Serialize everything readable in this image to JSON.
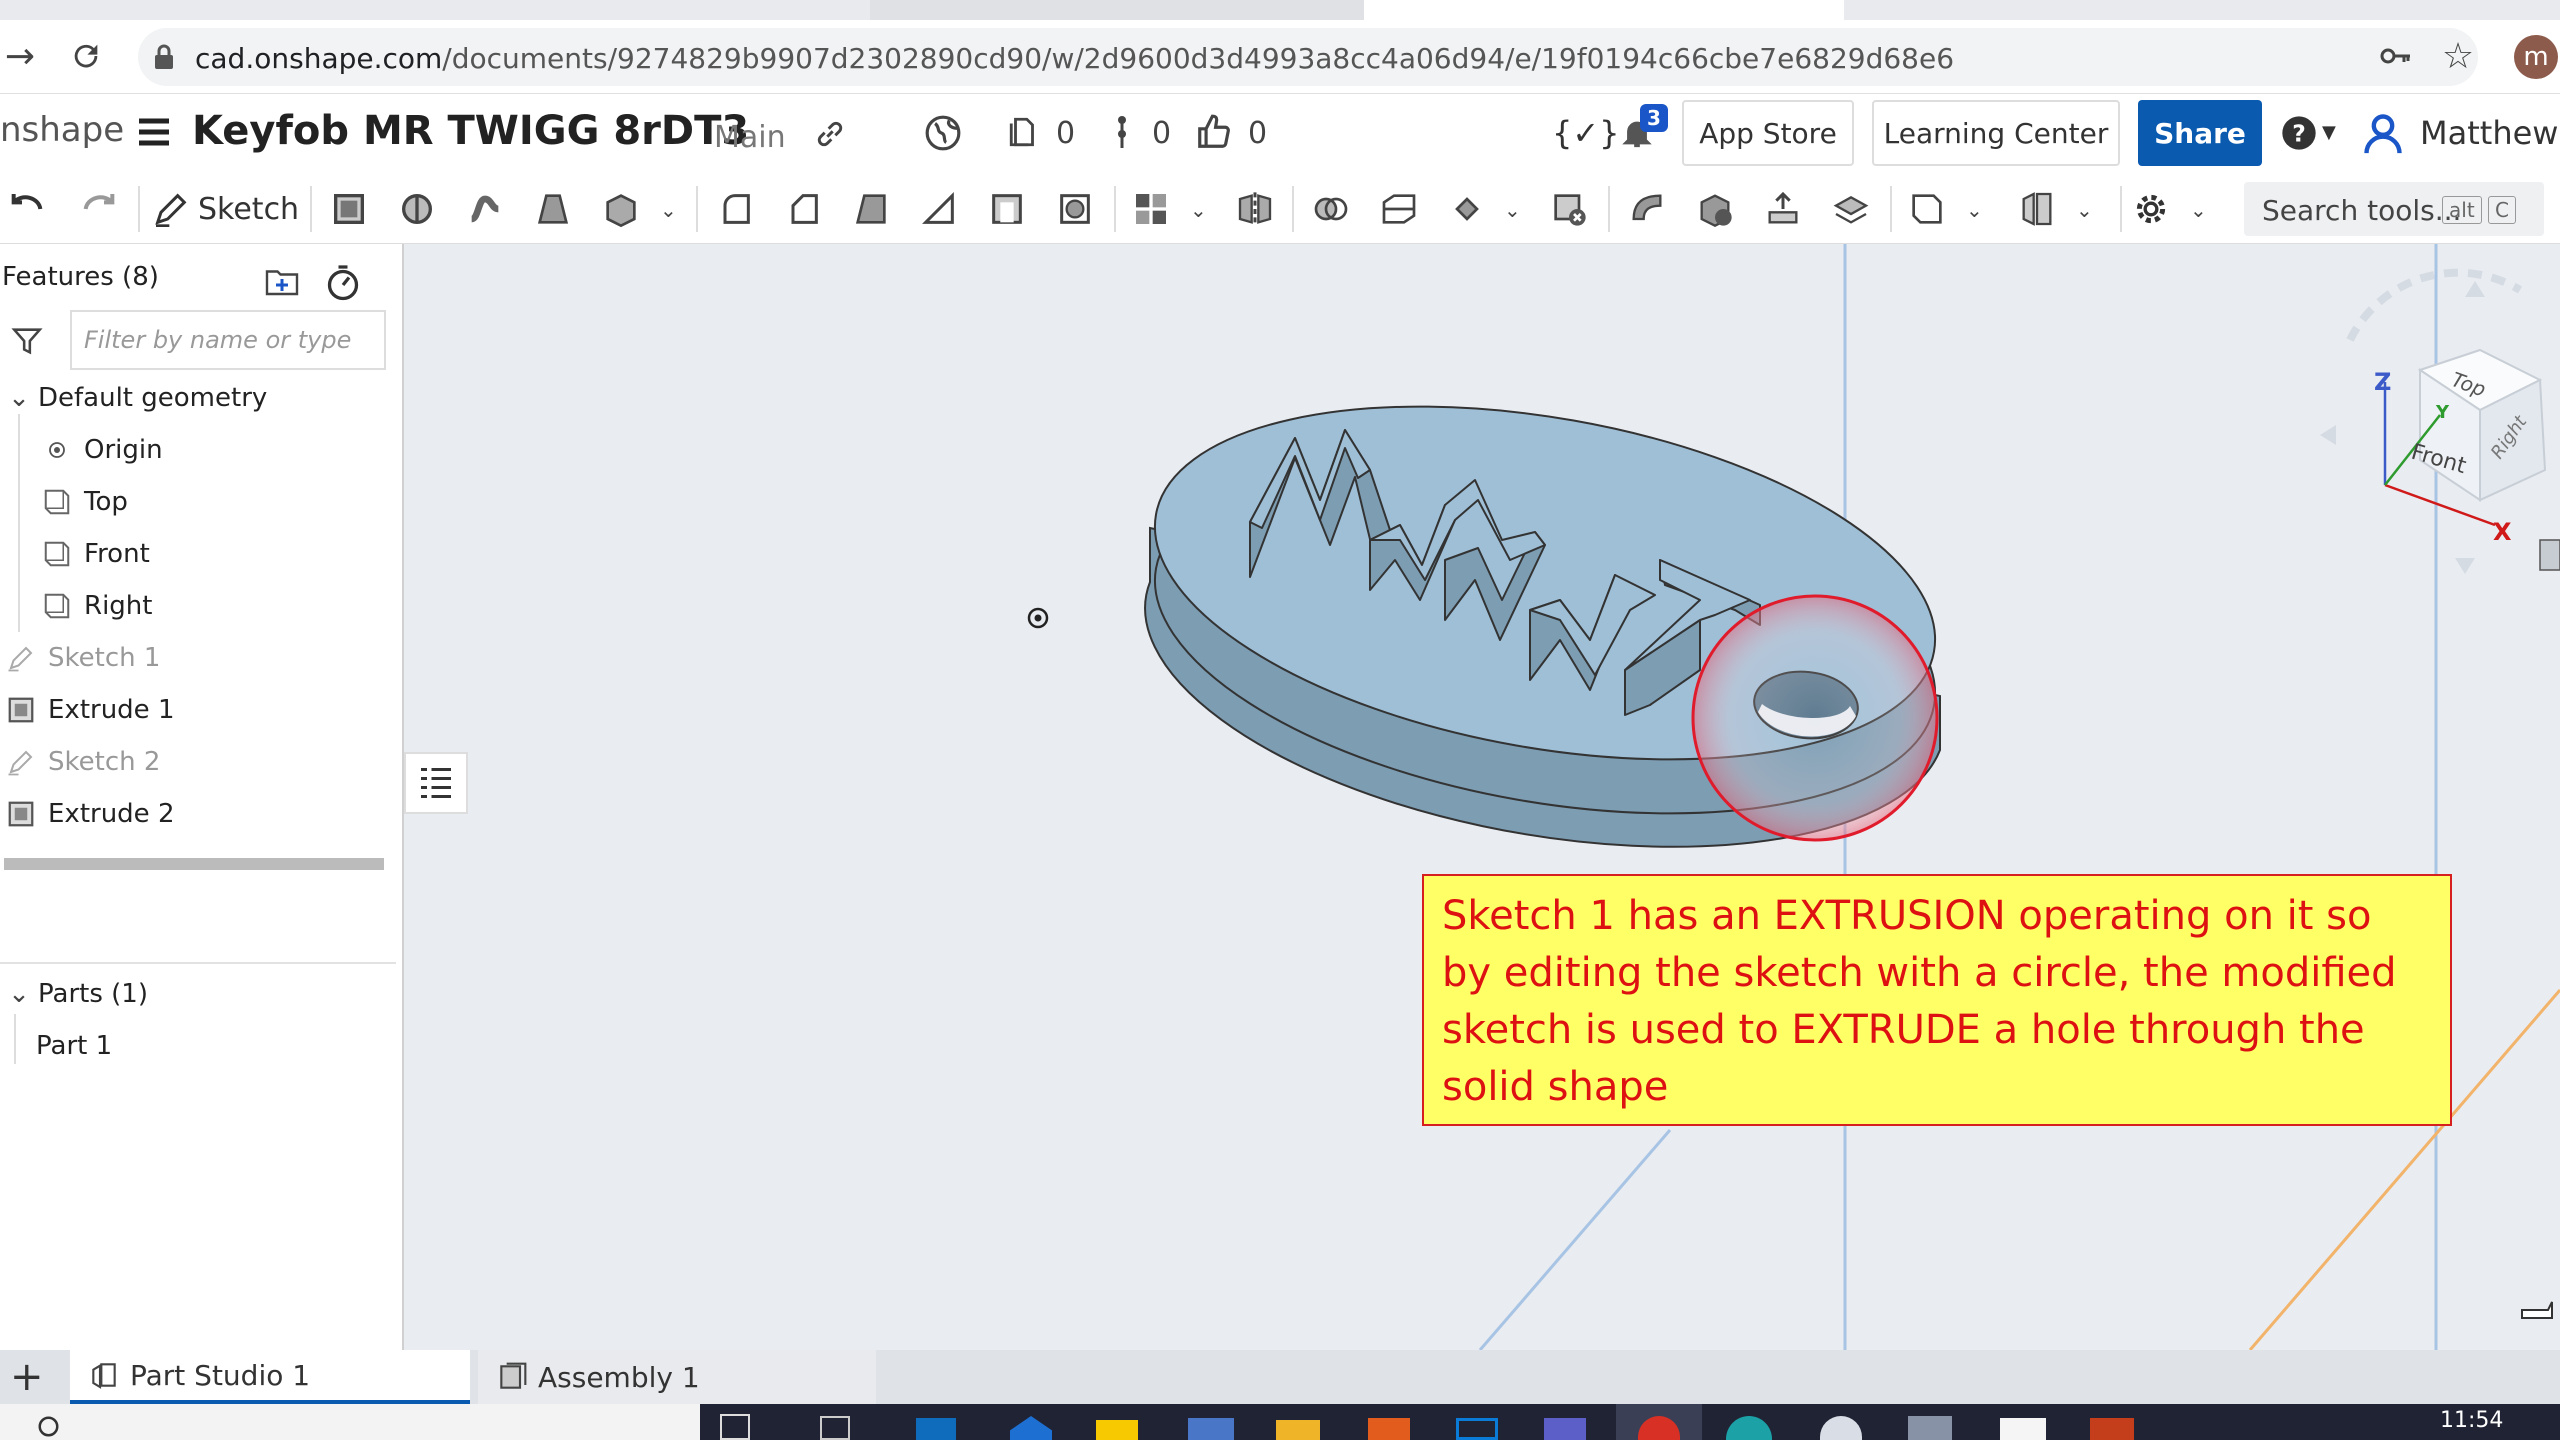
{
  "browser": {
    "url_domain": "cad.onshape.com",
    "url_path": "/documents/9274829b9907d2302890cd90/w/2d9600d3d4993a8cc4a06d94/e/19f0194c66cbe7e6829d68e6",
    "profile_initial": "m"
  },
  "header": {
    "logo": "nshape",
    "doc_title": "Keyfob MR TWIGG 8rDT3",
    "branch": "Main",
    "versions_count": "0",
    "branches_count": "0",
    "likes_count": "0",
    "notif_count": "3",
    "app_store": "App Store",
    "learning_center": "Learning Center",
    "share": "Share",
    "user_name": "Matthew Tw"
  },
  "toolbar": {
    "sketch_label": "Sketch",
    "search_placeholder": "Search tools...",
    "shortcut_alt": "alt",
    "shortcut_c": "C"
  },
  "features": {
    "title": "Features (8)",
    "filter_placeholder": "Filter by name or type",
    "default_geometry": "Default geometry",
    "origin": "Origin",
    "top": "Top",
    "front": "Front",
    "right": "Right",
    "sketch1": "Sketch 1",
    "extrude1": "Extrude 1",
    "sketch2": "Sketch 2",
    "extrude2": "Extrude 2"
  },
  "parts": {
    "title": "Parts (1)",
    "part1": "Part 1"
  },
  "viewcube": {
    "z": "Z",
    "x": "X",
    "y": "Y",
    "top": "Top",
    "front": "Front",
    "right": "Right"
  },
  "callout": {
    "text": "Sketch 1 has an EXTRUSION operating on it so by editing the sketch with a circle, the modified sketch is used to EXTRUDE a hole through the solid shape"
  },
  "tabs": {
    "part_studio": "Part Studio 1",
    "assembly": "Assembly 1"
  },
  "taskbar": {
    "time": "11:54"
  },
  "colors": {
    "share_blue": "#0a5bb0",
    "callout_bg": "#ffff66",
    "callout_text": "#dd1111",
    "model_fill": "#9fbfd6"
  }
}
